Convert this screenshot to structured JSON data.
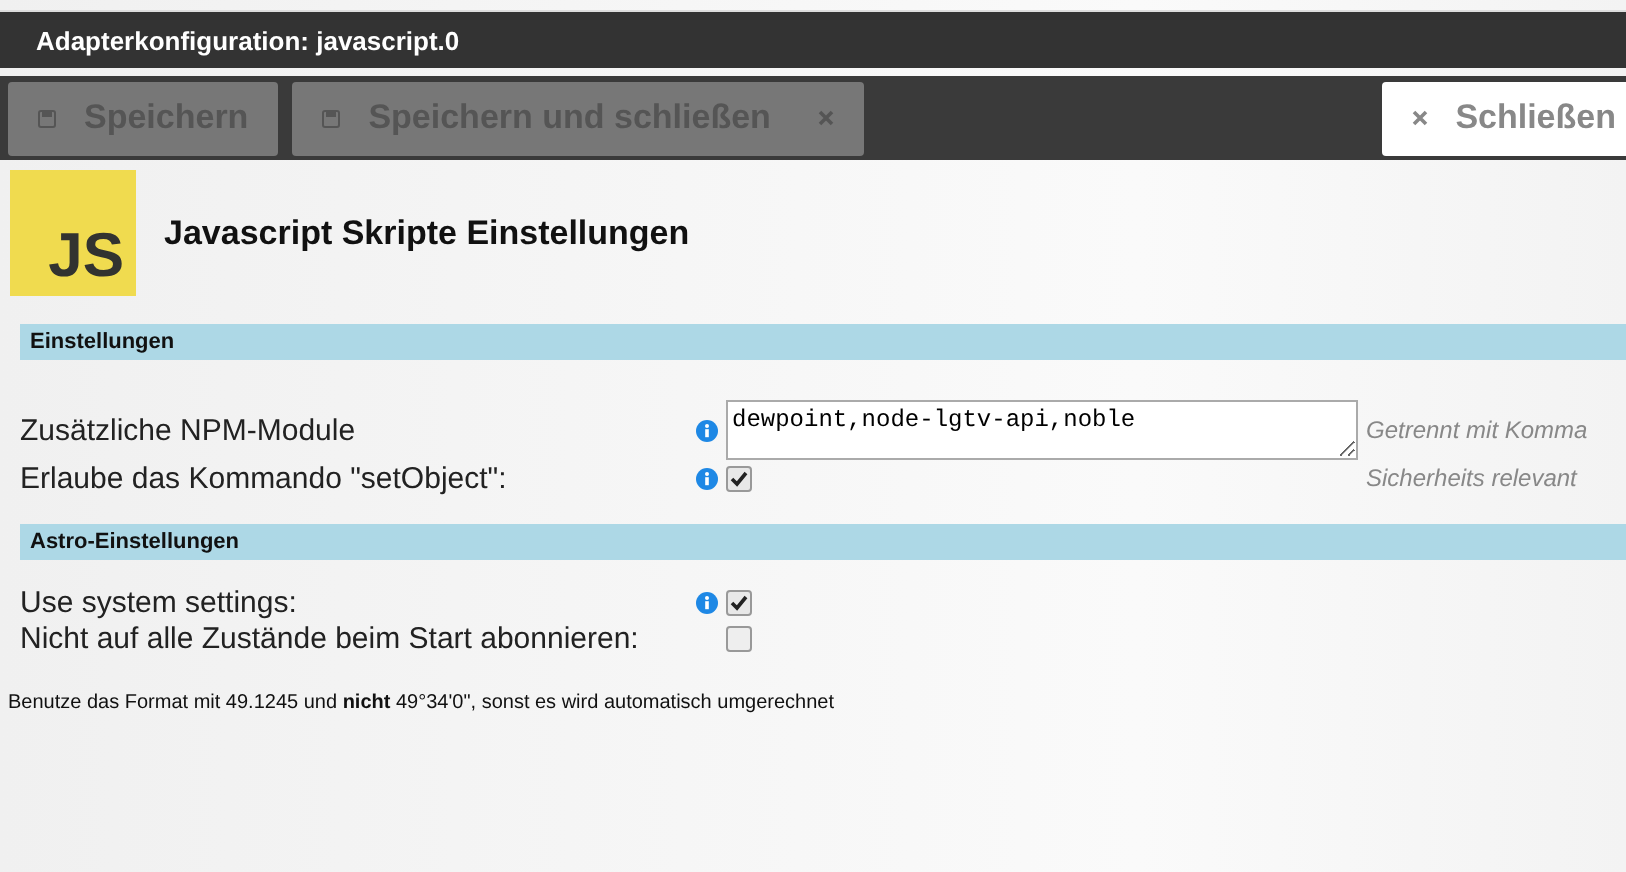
{
  "window": {
    "title": "Adapterkonfiguration: javascript.0"
  },
  "toolbar": {
    "buttons": [
      {
        "label": "Speichern",
        "kind": "save",
        "disabled": true,
        "close_mark": false
      },
      {
        "label": "Speichern und schließen",
        "kind": "save",
        "disabled": true,
        "close_mark": true
      },
      {
        "label": "Schließen",
        "kind": "close",
        "disabled": false,
        "close_mark": false
      }
    ]
  },
  "header": {
    "logo": "JS",
    "title": "Javascript Skripte Einstellungen"
  },
  "sections": [
    {
      "title": "Einstellungen",
      "rows": [
        {
          "label": "Zusätzliche NPM-Module",
          "info": true,
          "kind": "textarea",
          "value": "dewpoint,node-lgtv-api,noble",
          "hint": "Getrennt mit Komma"
        },
        {
          "label": "Erlaube das Kommando \"setObject\":",
          "info": true,
          "kind": "checkbox",
          "checked": true,
          "hint": "Sicherheits relevant"
        }
      ]
    },
    {
      "title": "Astro-Einstellungen",
      "rows": [
        {
          "label": "Use system settings:",
          "info": true,
          "kind": "checkbox",
          "checked": true
        },
        {
          "label": "Nicht auf alle Zustände beim Start abonnieren:",
          "info": false,
          "kind": "checkbox",
          "checked": false
        }
      ]
    }
  ],
  "footnote": "Benutze das Format mit 49.1245 und **nicht** 49°34'0\", sonst es wird automatisch umgerechnet"
}
